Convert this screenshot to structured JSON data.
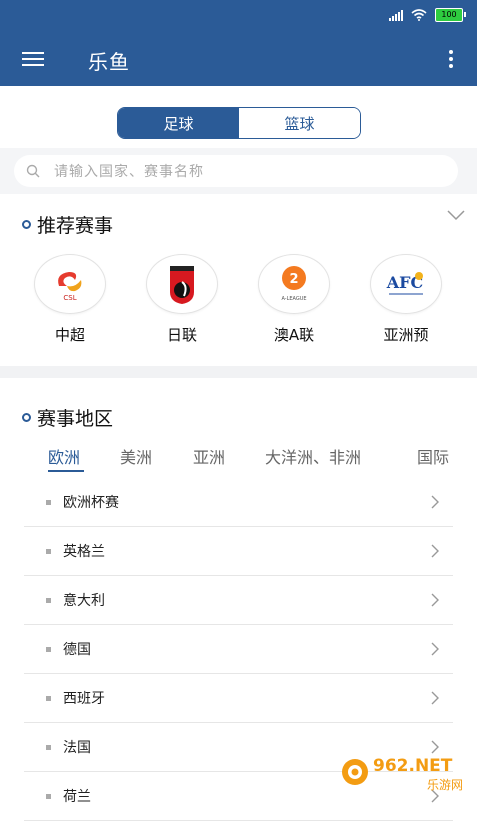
{
  "status": {
    "battery": "100"
  },
  "appbar": {
    "title": "乐鱼"
  },
  "segment": {
    "football": "足球",
    "basketball": "篮球"
  },
  "search": {
    "placeholder": "请输入国家、赛事名称"
  },
  "recommended": {
    "title": "推荐赛事",
    "leagues": [
      {
        "name": "中超",
        "logo_text": "CSL"
      },
      {
        "name": "日联",
        "logo_text": ""
      },
      {
        "name": "澳A联",
        "logo_text": "A-LEAGUE"
      },
      {
        "name": "亚洲预",
        "logo_text": "AFC"
      }
    ]
  },
  "regions": {
    "title": "赛事地区",
    "tabs": [
      "欧洲",
      "美洲",
      "亚洲",
      "大洋洲、非洲",
      "国际"
    ],
    "items": [
      "欧洲杯赛",
      "英格兰",
      "意大利",
      "德国",
      "西班牙",
      "法国",
      "荷兰"
    ]
  },
  "watermark": {
    "brand": "962.NET",
    "sub": "乐游网"
  },
  "colors": {
    "primary": "#2b5b97",
    "background_band": "#f1f2f4"
  }
}
